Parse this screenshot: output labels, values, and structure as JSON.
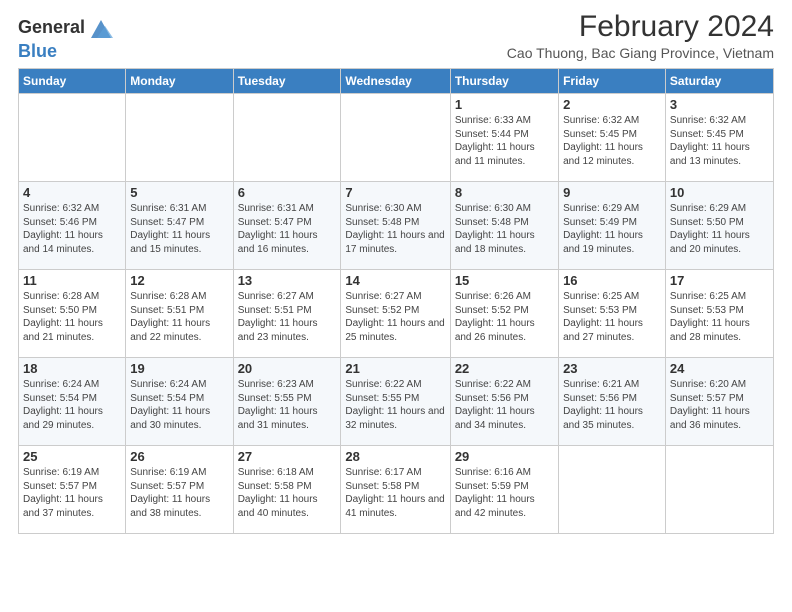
{
  "logo": {
    "text_general": "General",
    "text_blue": "Blue"
  },
  "header": {
    "title": "February 2024",
    "subtitle": "Cao Thuong, Bac Giang Province, Vietnam"
  },
  "weekdays": [
    "Sunday",
    "Monday",
    "Tuesday",
    "Wednesday",
    "Thursday",
    "Friday",
    "Saturday"
  ],
  "weeks": [
    [
      {
        "day": "",
        "info": ""
      },
      {
        "day": "",
        "info": ""
      },
      {
        "day": "",
        "info": ""
      },
      {
        "day": "",
        "info": ""
      },
      {
        "day": "1",
        "info": "Sunrise: 6:33 AM\nSunset: 5:44 PM\nDaylight: 11 hours and 11 minutes."
      },
      {
        "day": "2",
        "info": "Sunrise: 6:32 AM\nSunset: 5:45 PM\nDaylight: 11 hours and 12 minutes."
      },
      {
        "day": "3",
        "info": "Sunrise: 6:32 AM\nSunset: 5:45 PM\nDaylight: 11 hours and 13 minutes."
      }
    ],
    [
      {
        "day": "4",
        "info": "Sunrise: 6:32 AM\nSunset: 5:46 PM\nDaylight: 11 hours and 14 minutes."
      },
      {
        "day": "5",
        "info": "Sunrise: 6:31 AM\nSunset: 5:47 PM\nDaylight: 11 hours and 15 minutes."
      },
      {
        "day": "6",
        "info": "Sunrise: 6:31 AM\nSunset: 5:47 PM\nDaylight: 11 hours and 16 minutes."
      },
      {
        "day": "7",
        "info": "Sunrise: 6:30 AM\nSunset: 5:48 PM\nDaylight: 11 hours and 17 minutes."
      },
      {
        "day": "8",
        "info": "Sunrise: 6:30 AM\nSunset: 5:48 PM\nDaylight: 11 hours and 18 minutes."
      },
      {
        "day": "9",
        "info": "Sunrise: 6:29 AM\nSunset: 5:49 PM\nDaylight: 11 hours and 19 minutes."
      },
      {
        "day": "10",
        "info": "Sunrise: 6:29 AM\nSunset: 5:50 PM\nDaylight: 11 hours and 20 minutes."
      }
    ],
    [
      {
        "day": "11",
        "info": "Sunrise: 6:28 AM\nSunset: 5:50 PM\nDaylight: 11 hours and 21 minutes."
      },
      {
        "day": "12",
        "info": "Sunrise: 6:28 AM\nSunset: 5:51 PM\nDaylight: 11 hours and 22 minutes."
      },
      {
        "day": "13",
        "info": "Sunrise: 6:27 AM\nSunset: 5:51 PM\nDaylight: 11 hours and 23 minutes."
      },
      {
        "day": "14",
        "info": "Sunrise: 6:27 AM\nSunset: 5:52 PM\nDaylight: 11 hours and 25 minutes."
      },
      {
        "day": "15",
        "info": "Sunrise: 6:26 AM\nSunset: 5:52 PM\nDaylight: 11 hours and 26 minutes."
      },
      {
        "day": "16",
        "info": "Sunrise: 6:25 AM\nSunset: 5:53 PM\nDaylight: 11 hours and 27 minutes."
      },
      {
        "day": "17",
        "info": "Sunrise: 6:25 AM\nSunset: 5:53 PM\nDaylight: 11 hours and 28 minutes."
      }
    ],
    [
      {
        "day": "18",
        "info": "Sunrise: 6:24 AM\nSunset: 5:54 PM\nDaylight: 11 hours and 29 minutes."
      },
      {
        "day": "19",
        "info": "Sunrise: 6:24 AM\nSunset: 5:54 PM\nDaylight: 11 hours and 30 minutes."
      },
      {
        "day": "20",
        "info": "Sunrise: 6:23 AM\nSunset: 5:55 PM\nDaylight: 11 hours and 31 minutes."
      },
      {
        "day": "21",
        "info": "Sunrise: 6:22 AM\nSunset: 5:55 PM\nDaylight: 11 hours and 32 minutes."
      },
      {
        "day": "22",
        "info": "Sunrise: 6:22 AM\nSunset: 5:56 PM\nDaylight: 11 hours and 34 minutes."
      },
      {
        "day": "23",
        "info": "Sunrise: 6:21 AM\nSunset: 5:56 PM\nDaylight: 11 hours and 35 minutes."
      },
      {
        "day": "24",
        "info": "Sunrise: 6:20 AM\nSunset: 5:57 PM\nDaylight: 11 hours and 36 minutes."
      }
    ],
    [
      {
        "day": "25",
        "info": "Sunrise: 6:19 AM\nSunset: 5:57 PM\nDaylight: 11 hours and 37 minutes."
      },
      {
        "day": "26",
        "info": "Sunrise: 6:19 AM\nSunset: 5:57 PM\nDaylight: 11 hours and 38 minutes."
      },
      {
        "day": "27",
        "info": "Sunrise: 6:18 AM\nSunset: 5:58 PM\nDaylight: 11 hours and 40 minutes."
      },
      {
        "day": "28",
        "info": "Sunrise: 6:17 AM\nSunset: 5:58 PM\nDaylight: 11 hours and 41 minutes."
      },
      {
        "day": "29",
        "info": "Sunrise: 6:16 AM\nSunset: 5:59 PM\nDaylight: 11 hours and 42 minutes."
      },
      {
        "day": "",
        "info": ""
      },
      {
        "day": "",
        "info": ""
      }
    ]
  ]
}
